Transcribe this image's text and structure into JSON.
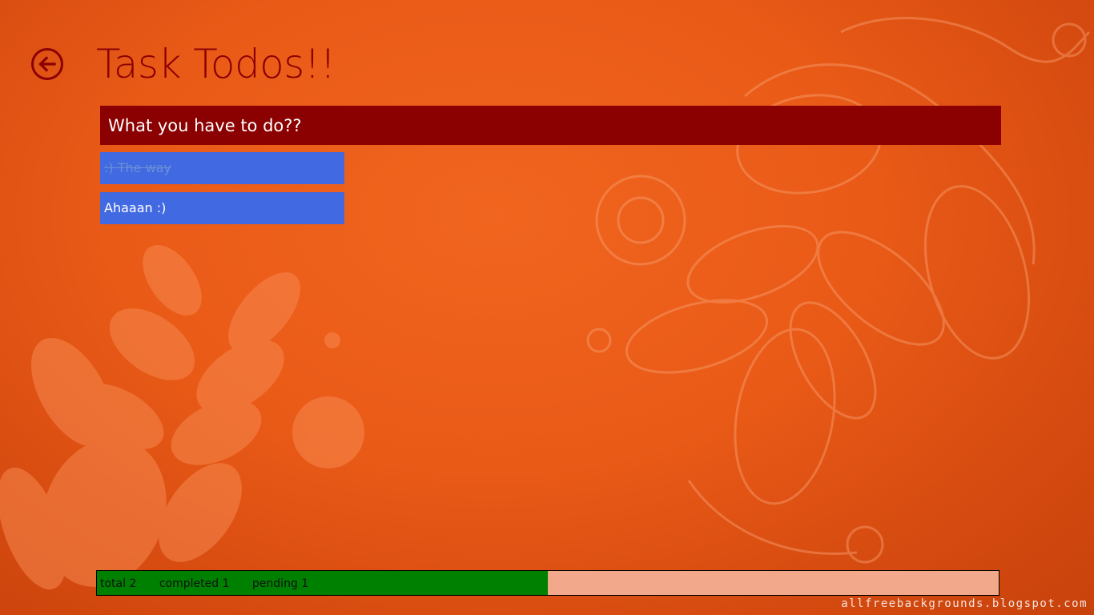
{
  "app": {
    "title": "Task Todos!!"
  },
  "header": {
    "back_icon": "arrow-left-circle-icon"
  },
  "input": {
    "placeholder": "What you have to do??",
    "value": ""
  },
  "todos": [
    {
      "label": ":) The way",
      "completed": true
    },
    {
      "label": "Ahaaan :)",
      "completed": false
    }
  ],
  "status": {
    "total_label": "total 2",
    "completed_label": "completed 1",
    "pending_label": "pending 1",
    "completed_fraction": 0.5
  },
  "watermark": "allfreebackgrounds.blogspot.com",
  "colors": {
    "title": "#8b0000",
    "input_bg": "#8b0000",
    "todo_bg": "#4169e1",
    "progress_fill": "#008000",
    "progress_track": "#f2a88a"
  }
}
